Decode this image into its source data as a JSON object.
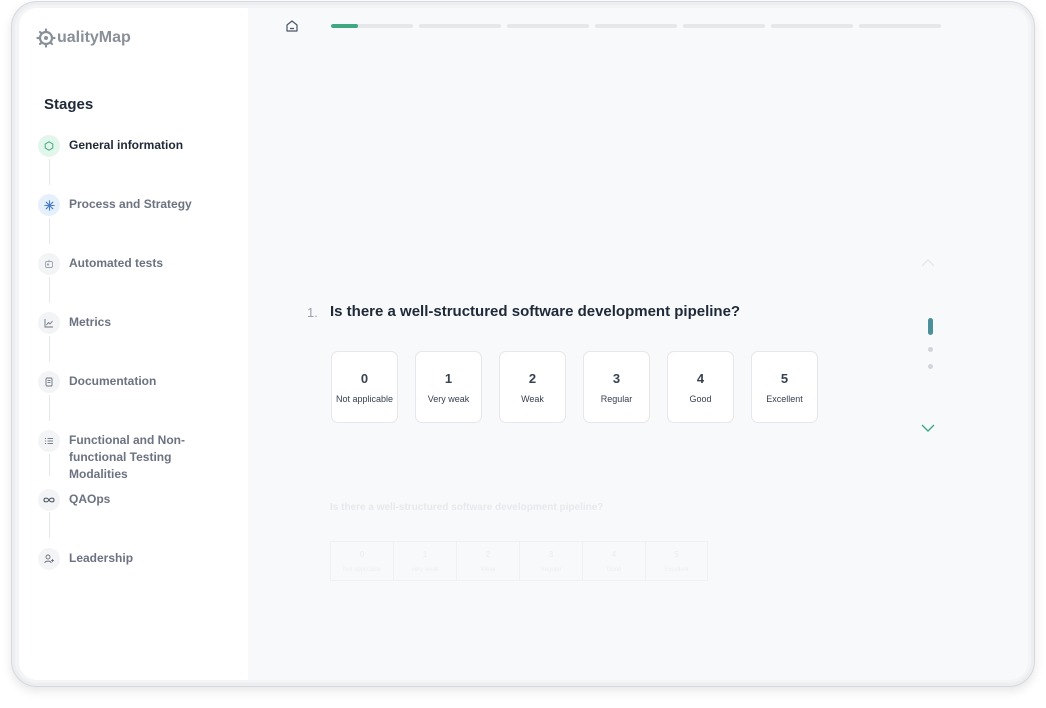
{
  "app": {
    "logo_text": "ualityMap"
  },
  "sidebar": {
    "title": "Stages",
    "items": [
      {
        "label": "General information",
        "icon": "hexagon-icon",
        "active": true
      },
      {
        "label": "Process and Strategy",
        "icon": "asterisk-icon"
      },
      {
        "label": "Automated tests",
        "icon": "robot-icon"
      },
      {
        "label": "Metrics",
        "icon": "chart-line-icon"
      },
      {
        "label": "Documentation",
        "icon": "document-icon"
      },
      {
        "label": "Functional and Non-functional Testing Modalities",
        "icon": "list-icon"
      },
      {
        "label": "QAOps",
        "icon": "infinity-icon"
      },
      {
        "label": "Leadership",
        "icon": "users-icon"
      }
    ]
  },
  "progress": {
    "segments": 7,
    "current_fraction": 0.33
  },
  "question": {
    "number": "1.",
    "text": "Is there a well-structured software development pipeline?",
    "options": [
      {
        "value": "0",
        "label": "Not applicable"
      },
      {
        "value": "1",
        "label": "Very weak"
      },
      {
        "value": "2",
        "label": "Weak"
      },
      {
        "value": "3",
        "label": "Regular"
      },
      {
        "value": "4",
        "label": "Good"
      },
      {
        "value": "5",
        "label": "Excellent"
      }
    ]
  },
  "next_question_preview": {
    "text": "Is there a well-structured software development pipeline?",
    "options": [
      {
        "value": "0",
        "label": "Not applicable"
      },
      {
        "value": "1",
        "label": "Very weak"
      },
      {
        "value": "2",
        "label": "Weak"
      },
      {
        "value": "3",
        "label": "Regular"
      },
      {
        "value": "4",
        "label": "Good"
      },
      {
        "value": "5",
        "label": "Excellent"
      }
    ]
  },
  "colors": {
    "accent": "#3fa883",
    "active_dot": "#4b8f9a",
    "text_dark": "#1f2937",
    "text_muted": "#6b7280"
  }
}
